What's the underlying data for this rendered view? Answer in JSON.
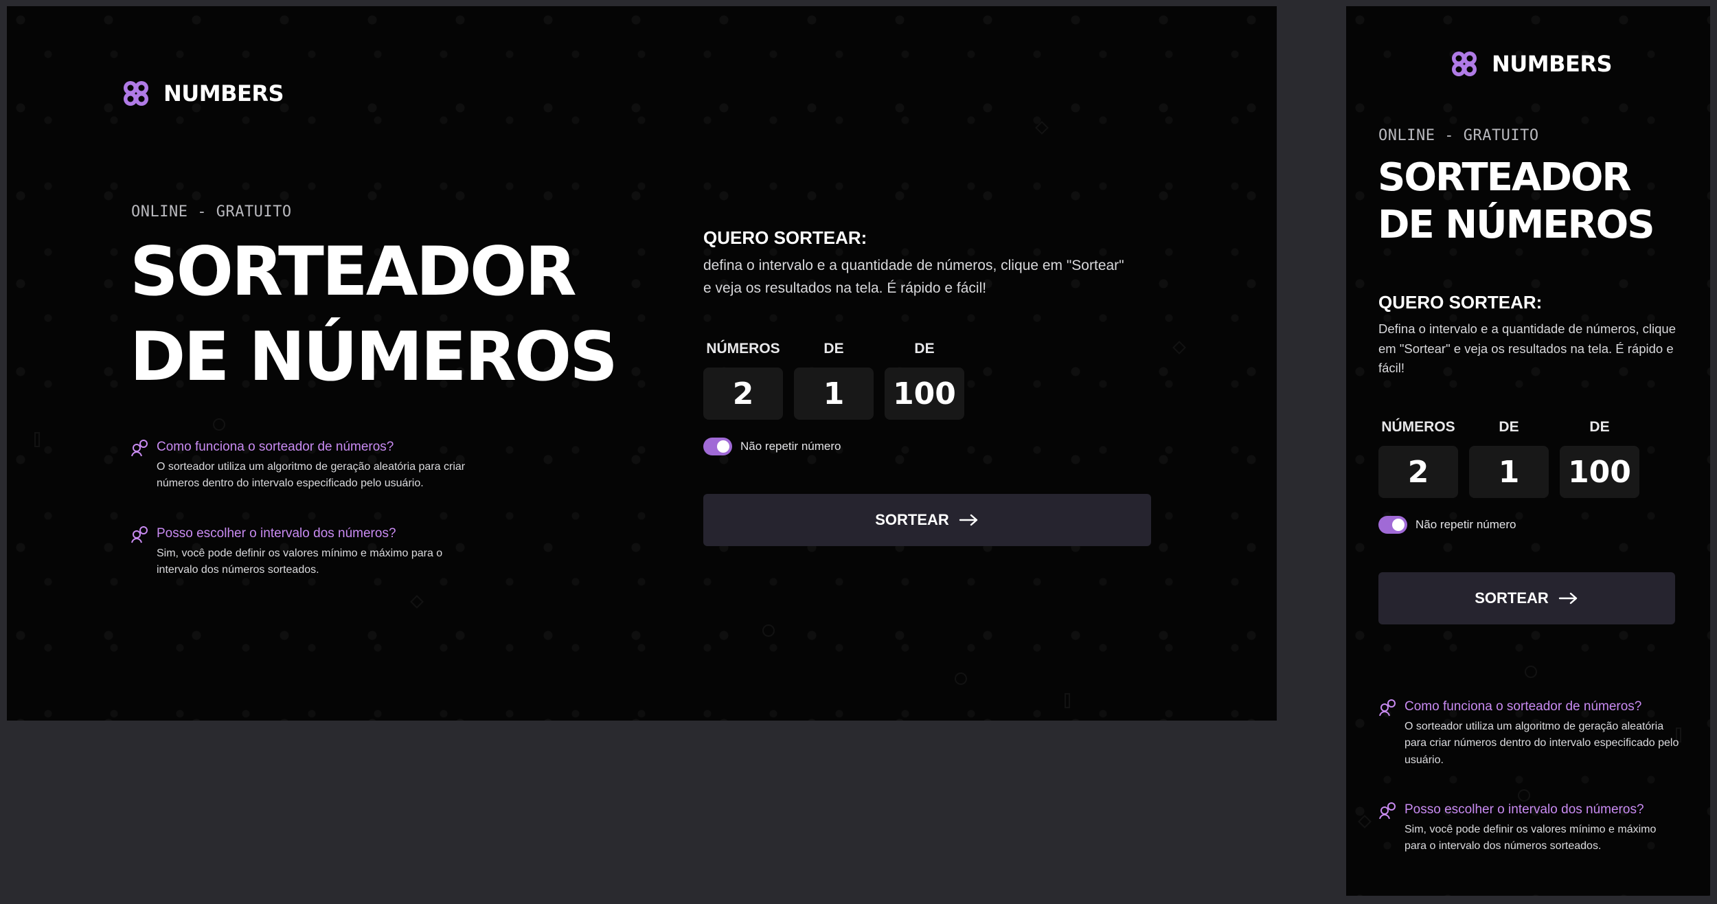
{
  "brand": {
    "name": "NUMBERS",
    "logo_icon": "numbers-logo-icon"
  },
  "hero": {
    "eyebrow": "ONLINE - GRATUITO",
    "title_line1": "SORTEADOR",
    "title_line2": "DE NÚMEROS"
  },
  "faq": [
    {
      "icon": "person-question-icon",
      "question": "Como funciona o sorteador de números?",
      "answer_line1": "O sorteador utiliza um algoritmo de geração aleatória para criar",
      "answer_line2": "números dentro do intervalo especificado pelo usuário.",
      "answer_mobile": "O sorteador utiliza um algoritmo de geração aleatória para criar números dentro do intervalo especificado pelo usuário."
    },
    {
      "icon": "person-question-icon",
      "question": "Posso escolher o intervalo dos números?",
      "answer_line1": "Sim, você pode definir os valores mínimo e máximo para o",
      "answer_line2": "intervalo dos números sorteados.",
      "answer_mobile": "Sim, você pode definir os valores mínimo e máximo para o intervalo dos números sorteados."
    }
  ],
  "panel": {
    "title": "QUERO SORTEAR:",
    "desc_line1": "defina o intervalo e a quantidade de números, clique em \"Sortear\"",
    "desc_line2": "e veja os resultados na tela. É rápido e fácil!",
    "desc_mobile": "Defina o intervalo e a quantidade de números, clique em \"Sortear\" e veja os resultados na tela. É rápido e fácil!"
  },
  "fields": [
    {
      "label": "NÚMEROS",
      "value": "2"
    },
    {
      "label": "DE",
      "value": "1"
    },
    {
      "label": "DE",
      "value": "100"
    }
  ],
  "toggle": {
    "label": "Não repetir número",
    "on": true
  },
  "button": {
    "label": "SORTEAR",
    "icon": "arrow-right-icon"
  },
  "colors": {
    "accent": "#C98BF2",
    "background": "#050505",
    "canvas": "#2A2A2F",
    "button": "#26242F",
    "field": "#181818"
  }
}
